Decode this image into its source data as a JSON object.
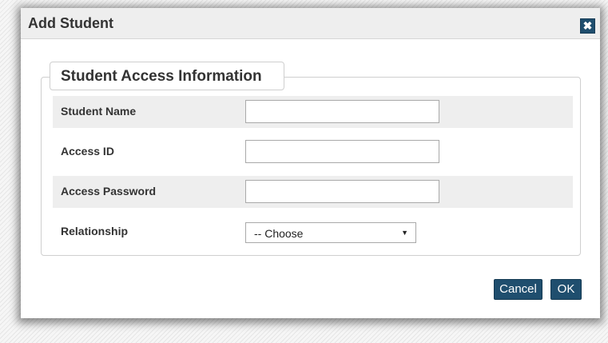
{
  "dialog": {
    "title": "Add Student",
    "close_icon_glyph": "✖"
  },
  "section": {
    "legend": "Student Access Information"
  },
  "fields": [
    {
      "label": "Student Name",
      "value": "",
      "placeholder": ""
    },
    {
      "label": "Access ID",
      "value": "",
      "placeholder": ""
    },
    {
      "label": "Access Password",
      "value": "",
      "placeholder": ""
    }
  ],
  "relationship": {
    "label": "Relationship",
    "selected": "-- Choose",
    "arrow_glyph": "▼"
  },
  "buttons": {
    "cancel": "Cancel",
    "ok": "OK"
  },
  "colors": {
    "button_bg": "#1f4e6e",
    "row_shade": "#eeeeee",
    "titlebar_bg": "#eeeeee"
  },
  "icons": {
    "close": "close-icon",
    "dropdown": "chevron-down-icon"
  }
}
